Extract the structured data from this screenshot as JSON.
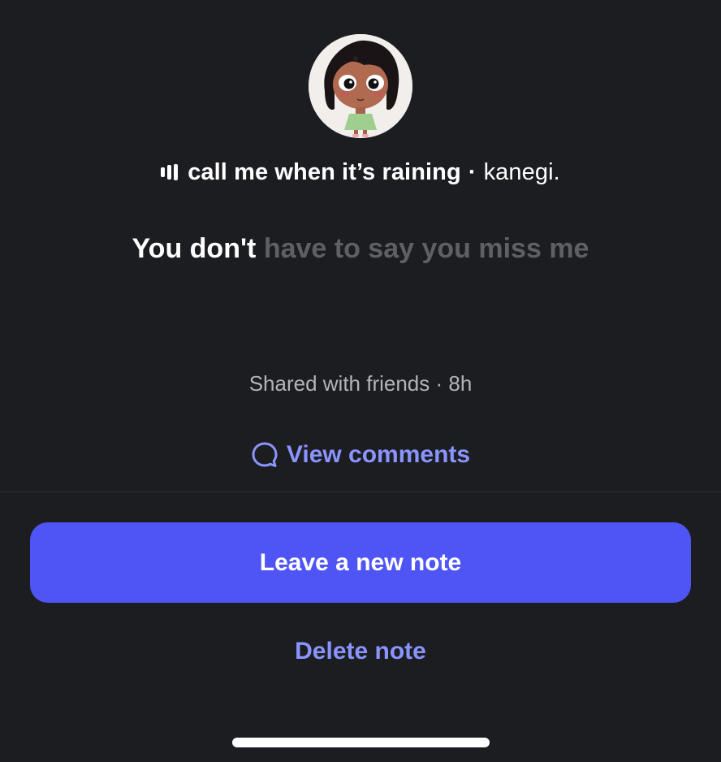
{
  "note": {
    "song_title": "call me when it’s raining",
    "separator": "·",
    "artist": "kanegi.",
    "lyric_active": "You don't",
    "lyric_upcoming": "have to say you miss me",
    "meta": "Shared with friends · 8h"
  },
  "actions": {
    "view_comments_label": "View comments",
    "leave_note_label": "Leave a new note",
    "delete_note_label": "Delete note"
  },
  "icons": {
    "music": "music-bars-icon",
    "comment": "comment-bubble-icon"
  },
  "colors": {
    "background": "#1c1d21",
    "accent": "#8a94ff",
    "primary_button": "#4f55f5",
    "muted_text": "#5f6066"
  }
}
